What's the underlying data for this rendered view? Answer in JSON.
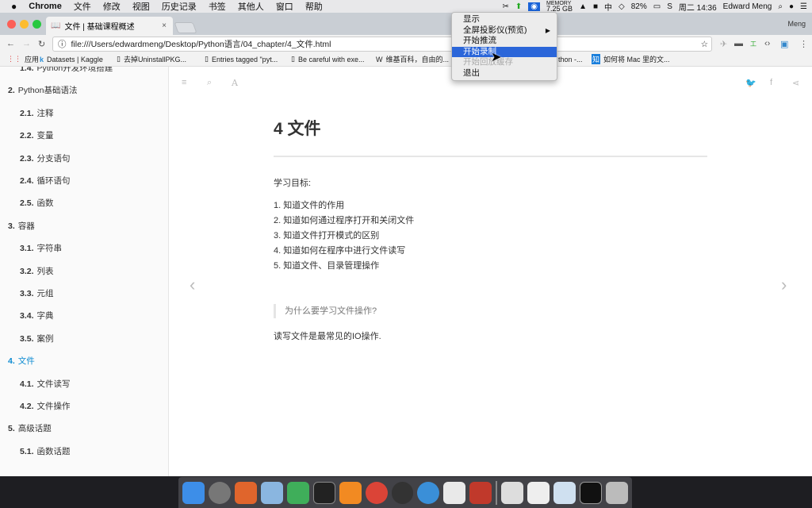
{
  "menubar": {
    "app": "Chrome",
    "items": [
      "文件",
      "修改",
      "视图",
      "历史记录",
      "书签",
      "其他人",
      "窗口",
      "帮助"
    ],
    "memory_label": "MEMORY",
    "memory": "7.25 GB",
    "battery": "82%",
    "clock": "周二 14:36",
    "user": "Edward Meng"
  },
  "browser": {
    "tab_title": "文件 | 基础课程概述",
    "profile": "Meng",
    "url": "file:///Users/edwardmeng/Desktop/Python语言/04_chapter/4_文件.html",
    "bookmarks": [
      "应用",
      "Datasets | Kaggle",
      "去掉UninstallPKG...",
      "Entries tagged \"pyt...",
      "Be careful with exe...",
      "维基百科，自由的...",
      "thon -...",
      "如何将 Mac 里的文..."
    ]
  },
  "context_menu": {
    "items": [
      {
        "label": "显示"
      },
      {
        "label": "全屏投影仪(预览)"
      },
      {
        "label": "开始推流"
      },
      {
        "label": "开始录制"
      },
      {
        "label": "开始回放缓存"
      },
      {
        "label": "退出"
      }
    ]
  },
  "sidebar": {
    "items": [
      {
        "num": "1.4.",
        "label": "Python开发环境搭建",
        "level": 2
      },
      {
        "num": "2.",
        "label": "Python基础语法",
        "level": 1
      },
      {
        "num": "2.1.",
        "label": "注释",
        "level": 2
      },
      {
        "num": "2.2.",
        "label": "变量",
        "level": 2
      },
      {
        "num": "2.3.",
        "label": "分支语句",
        "level": 2
      },
      {
        "num": "2.4.",
        "label": "循环语句",
        "level": 2
      },
      {
        "num": "2.5.",
        "label": "函数",
        "level": 2
      },
      {
        "num": "3.",
        "label": "容器",
        "level": 1
      },
      {
        "num": "3.1.",
        "label": "字符串",
        "level": 2
      },
      {
        "num": "3.2.",
        "label": "列表",
        "level": 2
      },
      {
        "num": "3.3.",
        "label": "元组",
        "level": 2
      },
      {
        "num": "3.4.",
        "label": "字典",
        "level": 2
      },
      {
        "num": "3.5.",
        "label": "案例",
        "level": 2
      },
      {
        "num": "4.",
        "label": "文件",
        "level": 1,
        "active": true
      },
      {
        "num": "4.1.",
        "label": "文件读写",
        "level": 2
      },
      {
        "num": "4.2.",
        "label": "文件操作",
        "level": 2
      },
      {
        "num": "5.",
        "label": "高级话题",
        "level": 1
      },
      {
        "num": "5.1.",
        "label": "函数话题",
        "level": 2
      }
    ]
  },
  "content": {
    "title": "4 文件",
    "goals_label": "学习目标:",
    "goals": [
      "1. 知道文件的作用",
      "2. 知道如何通过程序打开和关闭文件",
      "3. 知道文件打开模式的区别",
      "4. 知道如何在程序中进行文件读写",
      "5. 知道文件、目录管理操作"
    ],
    "quote": "为什么要学习文件操作?",
    "paragraph": "读写文件是最常见的IO操作."
  },
  "colors": {
    "accent": "#0b8ad1",
    "menu_selection": "#2b66d9"
  }
}
